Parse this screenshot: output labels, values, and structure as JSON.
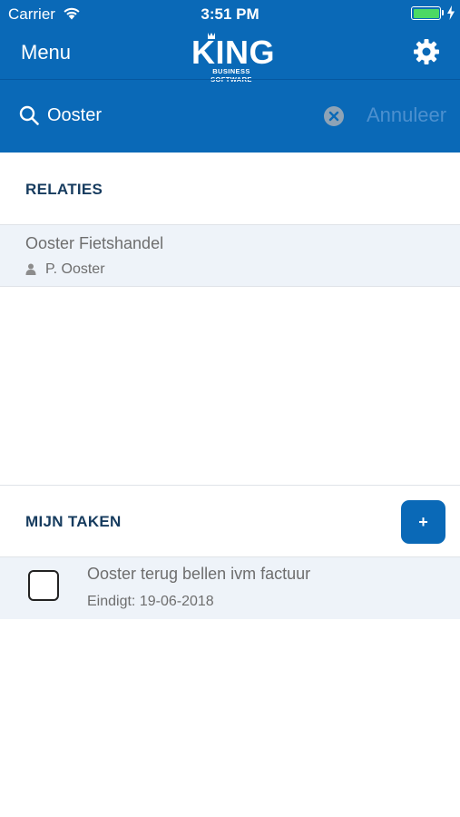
{
  "status_bar": {
    "carrier": "Carrier",
    "time": "3:51 PM",
    "battery_color": "#4cd964"
  },
  "nav": {
    "menu_label": "Menu",
    "logo_name": "KING",
    "logo_subtitle": "BUSINESS SOFTWARE",
    "settings_icon": "gear-icon"
  },
  "search": {
    "value": "Ooster",
    "cancel_label": "Annuleer",
    "icon": "search-icon",
    "clear_icon": "clear-icon"
  },
  "relaties": {
    "title": "RELATIES",
    "items": [
      {
        "name": "Ooster Fietshandel",
        "contact": "P. Ooster",
        "icon": "person-icon"
      }
    ]
  },
  "taken": {
    "title": "MIJN TAKEN",
    "add_label": "+",
    "items": [
      {
        "title": "Ooster terug bellen ivm factuur",
        "due": "Eindigt: 19-06-2018",
        "done": false
      }
    ]
  },
  "colors": {
    "brand_blue": "#0a69b7",
    "section_title": "#163b5e",
    "row_background": "#eef3f9"
  }
}
